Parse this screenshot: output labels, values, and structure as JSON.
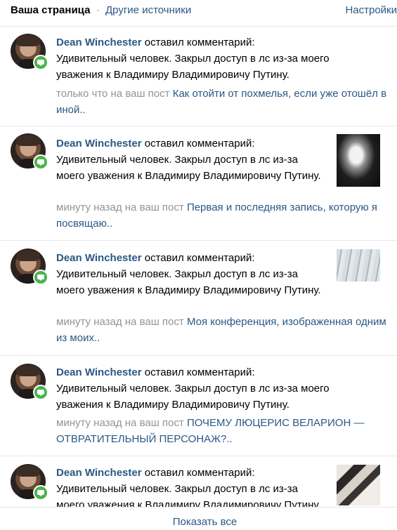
{
  "header": {
    "active_tab": "Ваша страница",
    "separator": "·",
    "other_tab": "Другие источники",
    "settings": "Настройки"
  },
  "colors": {
    "link": "#2a5885",
    "muted": "#939393",
    "badge": "#4bb34b",
    "divider": "#e7e8ec"
  },
  "notifications": [
    {
      "author": "Dean Winchester",
      "action": "оставил комментарий:",
      "comment": "Удивительный человек. Закрыл доступ в лс из-за моего уважения к Владимиру Владимировичу Путину.",
      "time": "только что на ваш пост",
      "post": "Как отойти от похмелья, если уже отошёл в иной.."
    },
    {
      "author": "Dean Winchester",
      "action": "оставил комментарий:",
      "comment": "Удивительный человек. Закрыл доступ в лс из-за моего уважения к Владимиру Владимировичу Путину.",
      "time": "минуту назад на ваш пост",
      "post": "Первая и последняя запись, которую я посвящаю.."
    },
    {
      "author": "Dean Winchester",
      "action": "оставил комментарий:",
      "comment": "Удивительный человек. Закрыл доступ в лс из-за моего уважения к Владимиру Владимировичу Путину.",
      "time": "минуту назад на ваш пост",
      "post": "Моя конференция, изображенная одним из моих.."
    },
    {
      "author": "Dean Winchester",
      "action": "оставил комментарий:",
      "comment": "Удивительный человек. Закрыл доступ в лс из-за моего уважения к Владимиру Владимировичу Путину.",
      "time": "минуту назад на ваш пост",
      "post": "ПОЧЕМУ ЛЮЦЕРИС ВЕЛАРИОН — ОТВРАТИТЕЛЬНЫЙ ПЕРСОНАЖ?.."
    },
    {
      "author": "Dean Winchester",
      "action": "оставил комментарий:",
      "comment": "Удивительный человек. Закрыл доступ в лс из-за моего уважения к Владимиру Владимировичу Путину."
    }
  ],
  "footer": {
    "show_all": "Показать все"
  }
}
